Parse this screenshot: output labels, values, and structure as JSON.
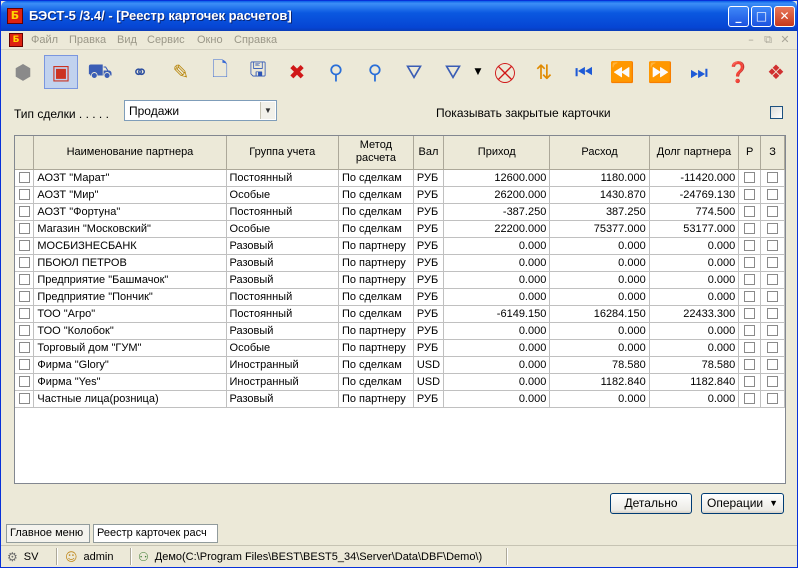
{
  "window": {
    "title": "БЭСТ-5 /3.4/ - [Реестр карточек расчетов]",
    "app_icon_letter": "Б",
    "controls": [
      "minimize-icon",
      "maximize-icon",
      "close-icon"
    ]
  },
  "menu": {
    "items": [
      "Файл",
      "Правка",
      "Вид",
      "Сервис",
      "Окно",
      "Справка"
    ]
  },
  "toolbar": {
    "icons": [
      "stone-icon",
      "register-icon",
      "cars-icon",
      "attach-icon",
      "edit-icon",
      "new-document-icon",
      "save-icon",
      "delete-icon",
      "find-icon",
      "find-next-icon",
      "filter-icon",
      "filter-options-icon",
      "dropdown-arrow-icon",
      "clear-filter-icon",
      "sort-icon",
      "first-record-icon",
      "previous-record-icon",
      "next-record-icon",
      "last-record-icon",
      "help-icon",
      "puzzle-icon"
    ]
  },
  "filter": {
    "deal_type_label": "Тип сделки . . . . .",
    "deal_type_value": "Продажи",
    "show_closed_label": "Показывать закрытые карточки",
    "show_closed_checked": false
  },
  "table": {
    "columns": [
      "Наименование партнера",
      "Группа учета",
      "Метод расчета",
      "Вал",
      "Приход",
      "Расход",
      "Долг партнера",
      "Р",
      "З"
    ],
    "rows": [
      {
        "name": "АОЗТ \"Марат\"",
        "group": "Постоянный",
        "method": "По сделкам",
        "currency": "РУБ",
        "income": "12600.000",
        "expense": "1180.000",
        "debt": "-11420.000"
      },
      {
        "name": "АОЗТ \"Мир\"",
        "group": "Особые",
        "method": "По сделкам",
        "currency": "РУБ",
        "income": "26200.000",
        "expense": "1430.870",
        "debt": "-24769.130"
      },
      {
        "name": "АОЗТ \"Фортуна\"",
        "group": "Постоянный",
        "method": "По сделкам",
        "currency": "РУБ",
        "income": "-387.250",
        "expense": "387.250",
        "debt": "774.500"
      },
      {
        "name": "Магазин \"Московский\"",
        "group": "Особые",
        "method": "По сделкам",
        "currency": "РУБ",
        "income": "22200.000",
        "expense": "75377.000",
        "debt": "53177.000"
      },
      {
        "name": "МОСБИЗНЕСБАНК",
        "group": "Разовый",
        "method": "По партнеру",
        "currency": "РУБ",
        "income": "0.000",
        "expense": "0.000",
        "debt": "0.000"
      },
      {
        "name": "ПБОЮЛ ПЕТРОВ",
        "group": "Разовый",
        "method": "По партнеру",
        "currency": "РУБ",
        "income": "0.000",
        "expense": "0.000",
        "debt": "0.000"
      },
      {
        "name": "Предприятие \"Башмачок\"",
        "group": "Разовый",
        "method": "По партнеру",
        "currency": "РУБ",
        "income": "0.000",
        "expense": "0.000",
        "debt": "0.000"
      },
      {
        "name": "Предприятие \"Пончик\"",
        "group": "Постоянный",
        "method": "По сделкам",
        "currency": "РУБ",
        "income": "0.000",
        "expense": "0.000",
        "debt": "0.000"
      },
      {
        "name": "ТОО \"Агро\"",
        "group": "Постоянный",
        "method": "По сделкам",
        "currency": "РУБ",
        "income": "-6149.150",
        "expense": "16284.150",
        "debt": "22433.300"
      },
      {
        "name": "ТОО \"Колобок\"",
        "group": "Разовый",
        "method": "По партнеру",
        "currency": "РУБ",
        "income": "0.000",
        "expense": "0.000",
        "debt": "0.000"
      },
      {
        "name": "Торговый дом \"ГУМ\"",
        "group": "Особые",
        "method": "По партнеру",
        "currency": "РУБ",
        "income": "0.000",
        "expense": "0.000",
        "debt": "0.000"
      },
      {
        "name": "Фирма \"Glory\"",
        "group": "Иностранный",
        "method": "По сделкам",
        "currency": "USD",
        "income": "0.000",
        "expense": "78.580",
        "debt": "78.580"
      },
      {
        "name": "Фирма \"Yes\"",
        "group": "Иностранный",
        "method": "По сделкам",
        "currency": "USD",
        "income": "0.000",
        "expense": "1182.840",
        "debt": "1182.840"
      },
      {
        "name": "Частные лица(розница)",
        "group": "Разовый",
        "method": "По партнеру",
        "currency": "РУБ",
        "income": "0.000",
        "expense": "0.000",
        "debt": "0.000"
      }
    ]
  },
  "buttons": {
    "details": "Детально",
    "operations": "Операции"
  },
  "tabs": [
    "Главное меню",
    "Реестр карточек расч"
  ],
  "status": {
    "server": "SV",
    "user": "admin",
    "database": "Демо(C:\\Program Files\\BEST\\BEST5_34\\Server\\Data\\DBF\\Demo\\)"
  }
}
